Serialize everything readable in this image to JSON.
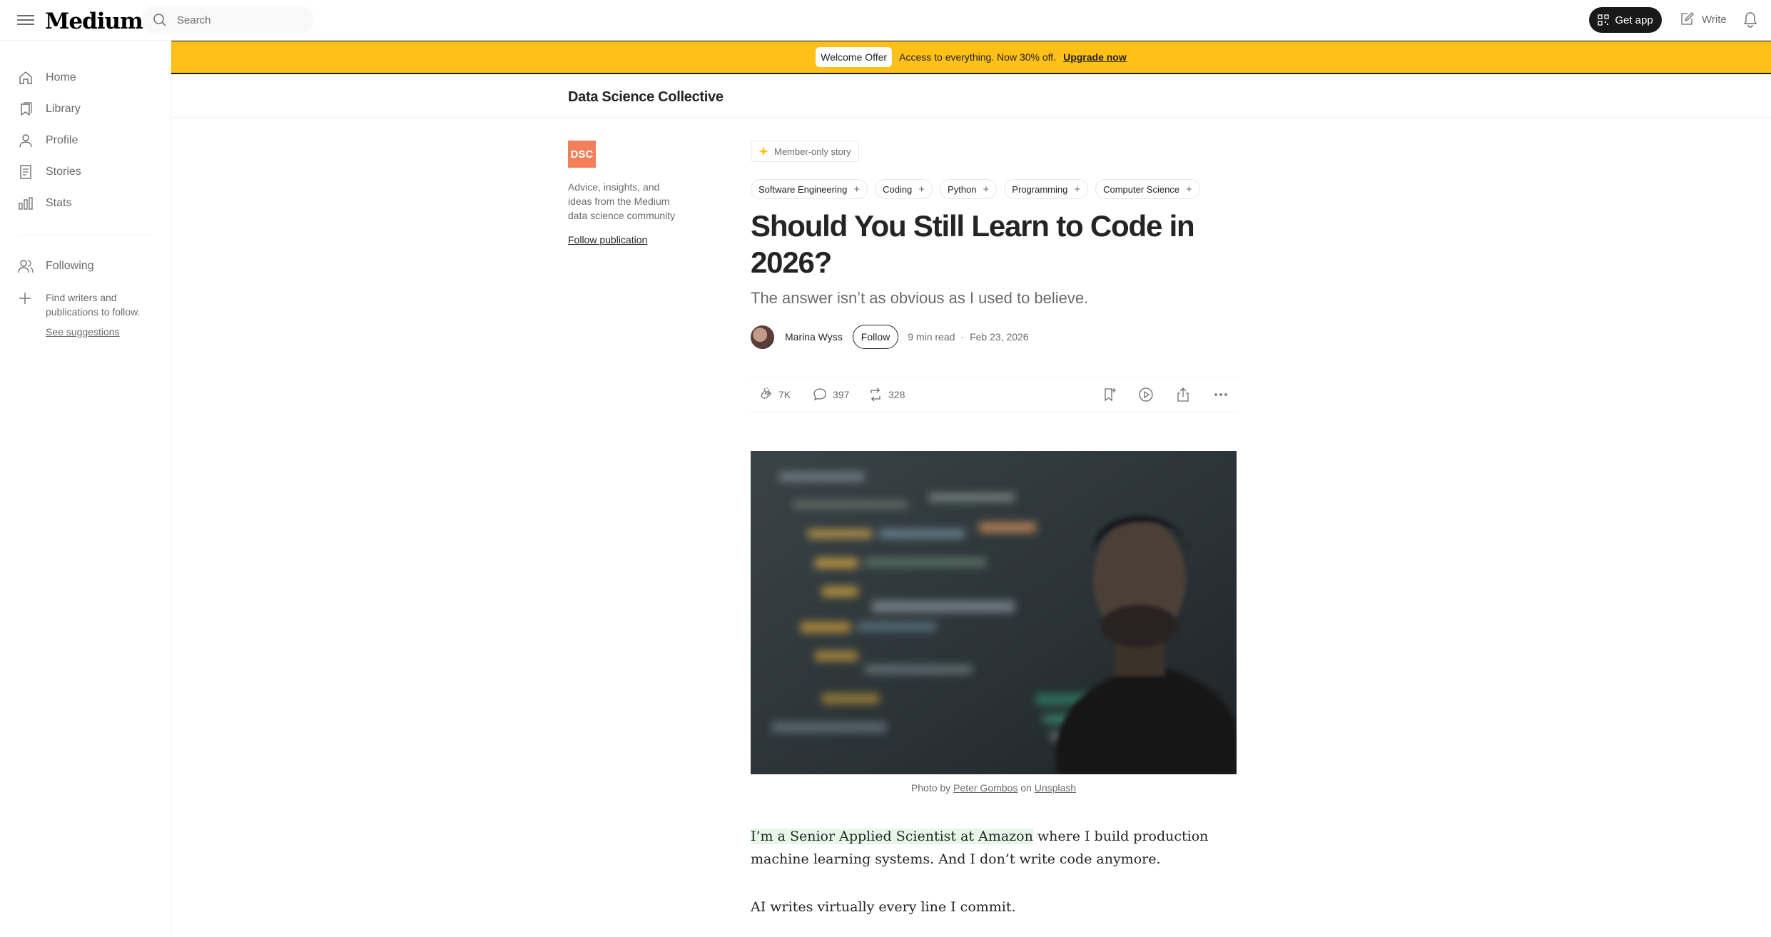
{
  "topbar": {
    "logo": "Medium",
    "search_placeholder": "Search",
    "get_app_label": "Get app",
    "write_label": "Write"
  },
  "sidebar": {
    "items": [
      {
        "label": "Home",
        "icon": "home-icon"
      },
      {
        "label": "Library",
        "icon": "bookmarks-icon"
      },
      {
        "label": "Profile",
        "icon": "person-icon"
      },
      {
        "label": "Stories",
        "icon": "document-icon"
      },
      {
        "label": "Stats",
        "icon": "bar-chart-icon"
      }
    ],
    "following_label": "Following",
    "find_text": "Find writers and publications to follow.",
    "see_suggestions": "See suggestions"
  },
  "banner": {
    "badge": "Welcome Offer",
    "text": "Access to everything. Now 30% off.",
    "cta": "Upgrade now"
  },
  "publication": {
    "name": "Data Science Collective",
    "logo_text": "DSC",
    "logo_color": "#f27e5a",
    "description": "Advice, insights, and ideas from the Medium data science community",
    "follow_label": "Follow publication"
  },
  "article": {
    "member_label": "Member-only story",
    "tags": [
      "Software Engineering",
      "Coding",
      "Python",
      "Programming",
      "Computer Science"
    ],
    "title": "Should You Still Learn to Code in 2026?",
    "subtitle": "The answer isn’t as obvious as I used to believe.",
    "author": "Marina Wyss",
    "follow_label": "Follow",
    "read_time": "9 min read",
    "date": "Feb 23, 2026",
    "claps": "7K",
    "responses": "397",
    "reposts": "328",
    "caption_prefix": "Photo by",
    "caption_author": "Peter Gombos",
    "caption_mid": "on",
    "caption_source": "Unsplash",
    "para1_highlight": "I’m a Senior Applied Scientist at Amazon",
    "para1_rest": " where I build production machine learning systems. And I don’t write code anymore.",
    "para2": "AI writes virtually every line I commit."
  },
  "colors": {
    "banner": "#ffc017",
    "accent_star": "#ffc017",
    "highlight": "#e7f6ea"
  }
}
